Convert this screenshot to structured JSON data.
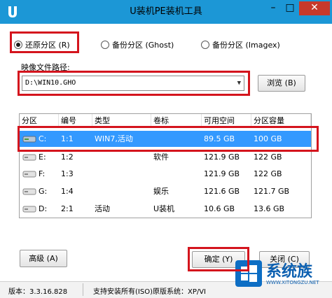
{
  "window": {
    "title": "U装机PE装机工具",
    "min_glyph": "–",
    "max_glyph": "□",
    "close_glyph": "✕"
  },
  "mode": {
    "options": [
      {
        "label": "还原分区 (R)",
        "selected": true
      },
      {
        "label": "备份分区 (Ghost)",
        "selected": false
      },
      {
        "label": "备份分区 (Imagex)",
        "selected": false
      }
    ]
  },
  "image_path": {
    "label": "映像文件路径:",
    "value": "D:\\WIN10.GHO",
    "browse_label": "浏览 (B)"
  },
  "table": {
    "columns": [
      "分区",
      "编号",
      "类型",
      "卷标",
      "可用空间",
      "分区容量"
    ],
    "rows": [
      {
        "drive": "C:",
        "num": "1:1",
        "type": "WIN7,活动",
        "label": "",
        "free": "89.5 GB",
        "size": "100 GB",
        "selected": true
      },
      {
        "drive": "E:",
        "num": "1:2",
        "type": "",
        "label": "软件",
        "free": "121.9 GB",
        "size": "122 GB",
        "selected": false
      },
      {
        "drive": "F:",
        "num": "1:3",
        "type": "",
        "label": "",
        "free": "121.9 GB",
        "size": "122 GB",
        "selected": false
      },
      {
        "drive": "G:",
        "num": "1:4",
        "type": "",
        "label": "娱乐",
        "free": "121.6 GB",
        "size": "121.7 GB",
        "selected": false
      },
      {
        "drive": "D:",
        "num": "2:1",
        "type": "活动",
        "label": "U装机",
        "free": "10.6 GB",
        "size": "13.6 GB",
        "selected": false
      }
    ]
  },
  "buttons": {
    "advanced": "高级 (A)",
    "ok": "确定 (Y)",
    "close": "关闭 (C)"
  },
  "status": {
    "version": "版本：3.3.16.828",
    "support": "支持安装所有(ISO)原版系统：XP/VI"
  },
  "watermark": {
    "name": "系统族",
    "url": "WWW.XITONGZU.NET"
  },
  "colors": {
    "titlebar": "#1c97d6",
    "selection": "#3399ff",
    "highlight": "#d4141d",
    "close": "#c7392b"
  }
}
